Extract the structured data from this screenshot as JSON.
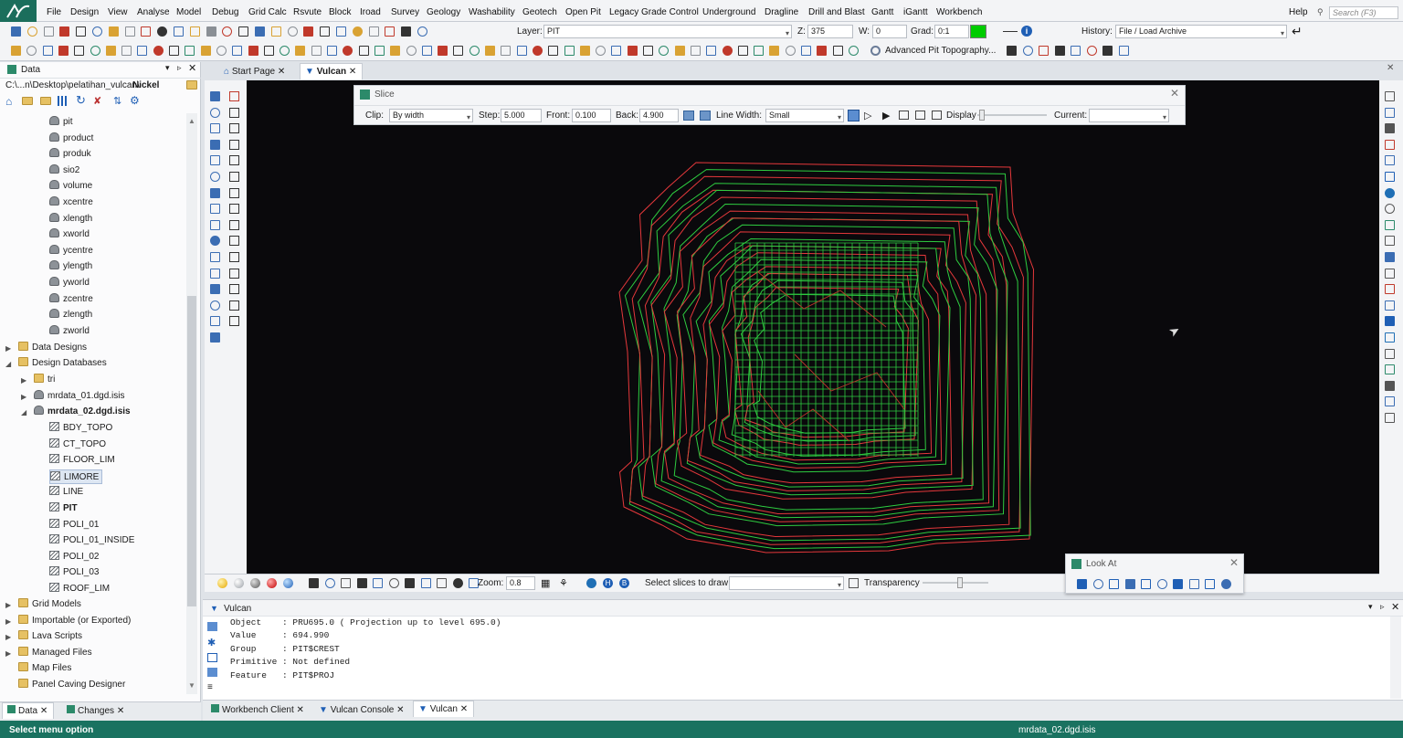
{
  "menu": [
    "File",
    "Design",
    "View",
    "Analyse",
    "Model",
    "Debug",
    "Grid Calc",
    "Rsvute",
    "Block",
    "Iroad",
    "Survey",
    "Geology",
    "Washability",
    "Geotech",
    "Open Pit",
    "Legacy Grade Control",
    "Underground",
    "Dragline",
    "Drill and Blast",
    "Gantt",
    "iGantt",
    "Workbench"
  ],
  "menu_right": {
    "help": "Help",
    "search_placeholder": "Search (F3)"
  },
  "toolbar": {
    "layer_label": "Layer:",
    "layer_value": "PIT",
    "z_label": "Z:",
    "z_value": "375",
    "w_label": "W:",
    "w_value": "0",
    "grad_label": "Grad:",
    "grad_value": "0:1",
    "history_label": "History:",
    "history_value": "File / Load Archive",
    "advanced_pit": "Advanced Pit Topography..."
  },
  "left_panel": {
    "title": "Data",
    "path": "C:\\...n\\Desktop\\pelatihan_vulcan\\",
    "path_bold": "Nickel",
    "fields": [
      "pit",
      "product",
      "produk",
      "sio2",
      "volume",
      "xcentre",
      "xlength",
      "xworld",
      "ycentre",
      "ylength",
      "yworld",
      "zcentre",
      "zlength",
      "zworld"
    ],
    "groups_top": [
      "Data Designs",
      "Design Databases"
    ],
    "db_items": [
      "tri",
      "mrdata_01.dgd.isis",
      "mrdata_02.dgd.isis"
    ],
    "layers": [
      "BDY_TOPO",
      "CT_TOPO",
      "FLOOR_LIM",
      "LIMORE",
      "LINE",
      "PIT",
      "POLI_01",
      "POLI_01_INSIDE",
      "POLI_02",
      "POLI_03",
      "ROOF_LIM"
    ],
    "groups_bottom": [
      "Grid Models",
      "Importable (or Exported)",
      "Lava Scripts",
      "Managed Files",
      "Map Files",
      "Panel Caving Designer"
    ],
    "tabs": [
      "Data",
      "Changes"
    ]
  },
  "doc_tabs": [
    "Start Page",
    "Vulcan"
  ],
  "slice": {
    "title": "Slice",
    "clip_label": "Clip:",
    "clip_value": "By width",
    "step_label": "Step:",
    "step_value": "5.000",
    "front_label": "Front:",
    "front_value": "0.100",
    "back_label": "Back:",
    "back_value": "4.900",
    "line_width_label": "Line Width:",
    "line_width_value": "Small",
    "display_label": "Display",
    "current_label": "Current:",
    "current_value": ""
  },
  "view_toolbar": {
    "zoom_label": "Zoom:",
    "zoom_value": "0.8",
    "select_slices_label": "Select slices to draw:",
    "transparency_label": "Transparency"
  },
  "look_at": {
    "title": "Look At"
  },
  "console": {
    "title": "Vulcan",
    "lines": [
      "Object    : PRU695.0 ( Projection up to level 695.0)",
      "Value     : 694.990",
      "Group     : PIT$CREST",
      "Primitive : Not defined",
      "Feature   : PIT$PROJ"
    ]
  },
  "bottom_tabs": [
    "Workbench Client",
    "Vulcan Console",
    "Vulcan"
  ],
  "status": {
    "left": "Select menu option",
    "right": "mrdata_02.dgd.isis"
  },
  "colors": {
    "status_bg": "#1a7260",
    "canvas_bg": "#0a090c",
    "pit_red": "#e5383b",
    "pit_green": "#2ecc40",
    "grad_swatch": "#00cc00"
  }
}
